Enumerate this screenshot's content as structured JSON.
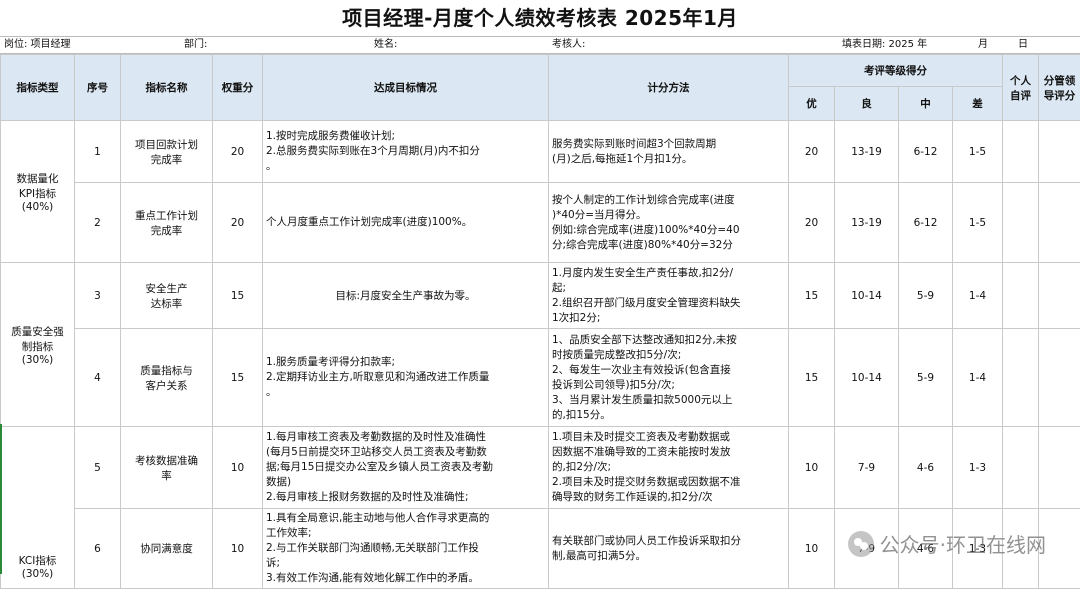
{
  "title": "项目经理-月度个人绩效考核表 2025年1月",
  "info": {
    "position": "岗位:   项目经理",
    "department": "部门:",
    "name": "姓名:",
    "assessor": "考核人:",
    "fill_date_label": "填表日期: 2025  年",
    "month_label": "月",
    "day_label": "日"
  },
  "headers": {
    "type": "指标类型",
    "seq": "序号",
    "name": "指标名称",
    "weight": "权重分",
    "target": "达成目标情况",
    "method": "计分方法",
    "grade": "考评等级得分",
    "you": "优",
    "liang": "良",
    "zhong": "中",
    "cha": "差",
    "self": "个人自评",
    "leader": "分管领导评分"
  },
  "groups": [
    {
      "label": "数据量化\nKPI指标\n(40%)"
    },
    {
      "label": "质量安全强\n制指标\n(30%)"
    },
    {
      "label": "KCI指标\n(30%)"
    }
  ],
  "rows": [
    {
      "seq": "1",
      "name": "项目回款计划\n完成率",
      "weight": "20",
      "target": "1.按时完成服务费催收计划;\n2.总服务费实际到账在3个月周期(月)内不扣分\n。",
      "method": "服务费实际到账时间超3个回款周期\n(月)之后,每拖延1个月扣1分。",
      "you": "20",
      "liang": "13-19",
      "zhong": "6-12",
      "cha": "1-5"
    },
    {
      "seq": "2",
      "name": "重点工作计划\n完成率",
      "weight": "20",
      "target": "个人月度重点工作计划完成率(进度)100%。",
      "method": "按个人制定的工作计划综合完成率(进度\n)*40分=当月得分。\n例如:综合完成率(进度)100%*40分=40\n分;综合完成率(进度)80%*40分=32分",
      "you": "20",
      "liang": "13-19",
      "zhong": "6-12",
      "cha": "1-5"
    },
    {
      "seq": "3",
      "name": "安全生产\n达标率",
      "weight": "15",
      "target": "目标:月度安全生产事故为零。",
      "method": "1.月度内发生安全生产责任事故,扣2分/\n起;\n2.组织召开部门级月度安全管理资料缺失\n1次扣2分;",
      "you": "15",
      "liang": "10-14",
      "zhong": "5-9",
      "cha": "1-4"
    },
    {
      "seq": "4",
      "name": "质量指标与\n客户关系",
      "weight": "15",
      "target": "1.服务质量考评得分扣款率;\n2.定期拜访业主方,听取意见和沟通改进工作质量\n。",
      "method": "1、品质安全部下达整改通知扣2分,未按\n时按质量完成整改扣5分/次;\n2、每发生一次业主有效投诉(包含直接\n投诉到公司领导)扣5分/次;\n3、当月累计发生质量扣款5000元以上\n的,扣15分。",
      "you": "15",
      "liang": "10-14",
      "zhong": "5-9",
      "cha": "1-4"
    },
    {
      "seq": "5",
      "name": "考核数据准确\n率",
      "weight": "10",
      "target": "1.每月审核工资表及考勤数据的及时性及准确性\n(每月5日前提交环卫站移交人员工资表及考勤数\n据;每月15日提交办公室及乡镇人员工资表及考勤\n数据)\n2.每月审核上报财务数据的及时性及准确性;",
      "method": "1.项目未及时提交工资表及考勤数据或\n因数据不准确导致的工资未能按时发放\n的,扣2分/次;\n2.项目未及时提交财务数据或因数据不准\n确导致的财务工作延误的,扣2分/次",
      "you": "10",
      "liang": "7-9",
      "zhong": "4-6",
      "cha": "1-3"
    },
    {
      "seq": "6",
      "name": "协同满意度",
      "weight": "10",
      "target": "1.具有全局意识,能主动地与他人合作寻求更高的\n工作效率;\n2.与工作关联部门沟通顺畅,无关联部门工作投\n诉;\n3.有效工作沟通,能有效地化解工作中的矛盾。",
      "method": "有关联部门或协同人员工作投诉采取扣分\n制,最高可扣满5分。",
      "you": "10",
      "liang": "7-9",
      "zhong": "4-6",
      "cha": "1-3"
    }
  ],
  "watermark": "公众号·环卫在线网"
}
